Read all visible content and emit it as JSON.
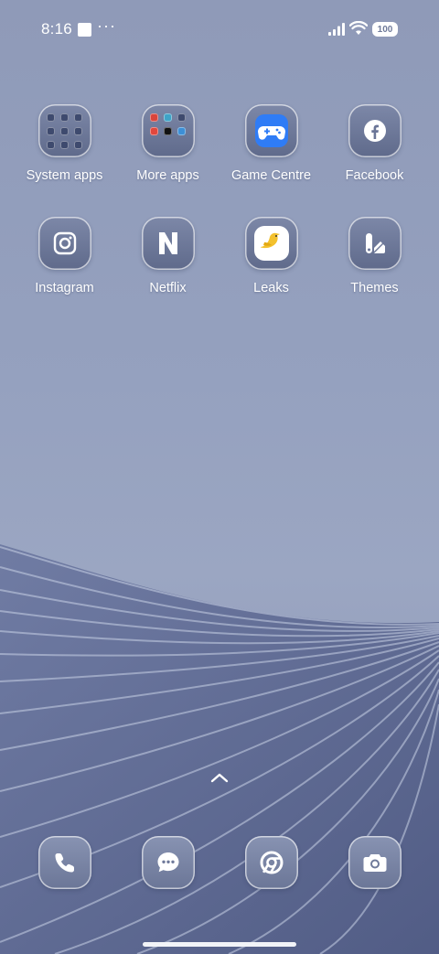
{
  "status_bar": {
    "time": "8:16",
    "overflow_indicator": "···",
    "battery_level": "100"
  },
  "apps": [
    {
      "id": "system-apps",
      "label": "System apps",
      "icon": "folder-icon"
    },
    {
      "id": "more-apps",
      "label": "More apps",
      "icon": "folder-icon"
    },
    {
      "id": "game-centre",
      "label": "Game Centre",
      "icon": "gamepad-icon"
    },
    {
      "id": "facebook",
      "label": "Facebook",
      "icon": "facebook-icon"
    },
    {
      "id": "instagram",
      "label": "Instagram",
      "icon": "instagram-icon"
    },
    {
      "id": "netflix",
      "label": "Netflix",
      "icon": "netflix-icon"
    },
    {
      "id": "leaks",
      "label": "Leaks",
      "icon": "bird-icon"
    },
    {
      "id": "themes",
      "label": "Themes",
      "icon": "themes-icon"
    }
  ],
  "dock": [
    {
      "id": "phone",
      "icon": "phone-icon"
    },
    {
      "id": "messages",
      "icon": "message-icon"
    },
    {
      "id": "chrome",
      "icon": "chrome-icon"
    },
    {
      "id": "camera",
      "icon": "camera-icon"
    }
  ],
  "colors": {
    "wallpaper_top": "#8f9ab8",
    "wallpaper_wave": "#5d6890",
    "game_centre_accent": "#2f7cf6",
    "leaks_accent": "#f3c12e"
  }
}
